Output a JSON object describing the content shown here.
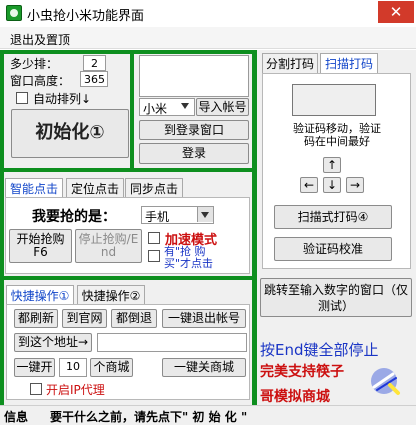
{
  "window": {
    "title": "小虫抢小米功能界面",
    "close_glyph": "✕"
  },
  "menu": {
    "items": [
      "退出及置顶"
    ]
  },
  "left_top": {
    "rows_label": "多少排：",
    "rows_value": "2",
    "height_label": "窗口高度：",
    "height_value": "365",
    "auto_arrange_label": "自动排列↓",
    "init_button": "初始化①",
    "account_select": "小米",
    "import_button": "导入帐号",
    "jump_login_button": "到登录窗口",
    "login_button": "登录"
  },
  "click_tabs": [
    "智能点击",
    "定位点击",
    "同步点击"
  ],
  "click_panel": {
    "want_label": "我要抢的是：",
    "product_select": "手机",
    "start_button": "开始抢购\nF6",
    "stop_button": "停止抢购/E\nnd",
    "accelerate_label": "加速模式",
    "quote_label": "有\"抢 购\n买\"才点击"
  },
  "quick_tabs": [
    "快捷操作①",
    "快捷操作②"
  ],
  "quick_panel": {
    "refresh_button": "都刷新",
    "official_button": "到官网",
    "back_button": "都倒退",
    "logout_button": "一键退出帐号",
    "goto_address_button": "到这个地址→",
    "address_value": "",
    "open_prefix_button": "一键开",
    "open_count": "10",
    "open_suffix_label": "个商城",
    "close_mall_button": "一键关商城",
    "ip_proxy_label": "开启IP代理"
  },
  "right_tabs": [
    "分割打码",
    "扫描打码"
  ],
  "right_panel": {
    "captcha_hint": "验证码移动，验证\n码在中间最好",
    "arrows": [
      "↑",
      "←",
      "↓",
      "→"
    ],
    "scan_button": "扫描式打码④",
    "calibrate_button": "验证码校准",
    "jump_input_button": "跳转至输入数字的窗口（仅\n测试）",
    "end_hint": "按End键全部停止",
    "promo_line1": "完美支持筷子",
    "promo_line2": "哥模拟商城"
  },
  "status_bar": {
    "info_label": "信息",
    "message": "要干什么之前，请先点下\" 初 始 化 \""
  },
  "colors": {
    "accent_green": "#0e8f1f",
    "tab_blue": "#1145c9",
    "red_text": "#cc1010",
    "blue_text": "#1a35c5"
  }
}
